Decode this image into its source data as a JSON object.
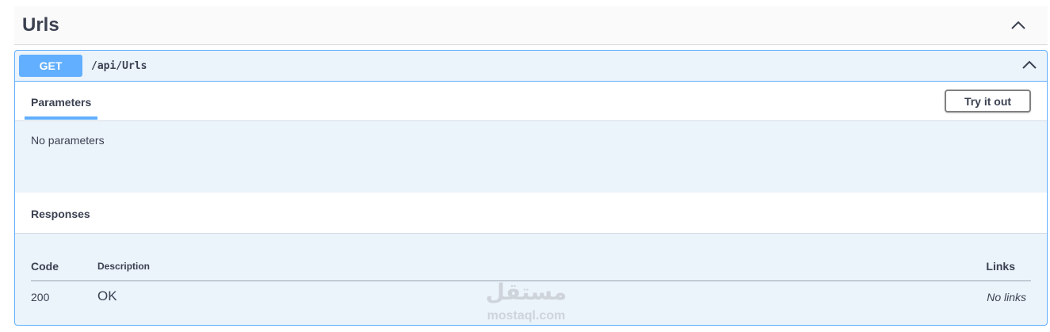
{
  "tag": {
    "title": "Urls",
    "chevron_icon": "chevron-up-icon"
  },
  "operation": {
    "method": "GET",
    "path": "/api/Urls",
    "method_color": "#61affe",
    "chevron_icon": "chevron-up-icon"
  },
  "parameters": {
    "tab_label": "Parameters",
    "try_button_label": "Try it out",
    "empty_text": "No parameters"
  },
  "responses": {
    "title": "Responses",
    "columns": [
      "Code",
      "Description",
      "Links"
    ],
    "rows": [
      {
        "code": "200",
        "description": "OK",
        "links": "No links"
      }
    ]
  },
  "watermark": {
    "arabic": "مستقل",
    "latin": "mostaql.com"
  }
}
